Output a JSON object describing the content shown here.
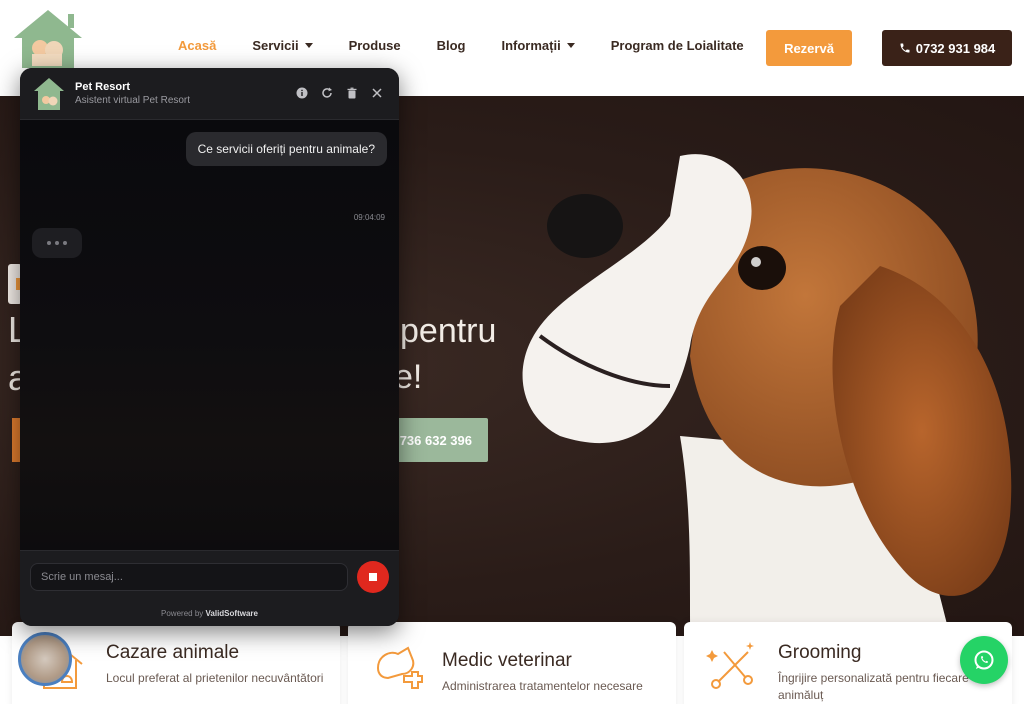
{
  "header": {
    "nav": [
      {
        "label": "Acasă",
        "active": true,
        "dropdown": false
      },
      {
        "label": "Servicii",
        "active": false,
        "dropdown": true
      },
      {
        "label": "Produse",
        "active": false,
        "dropdown": false
      },
      {
        "label": "Blog",
        "active": false,
        "dropdown": false
      },
      {
        "label": "Informații",
        "active": false,
        "dropdown": true
      },
      {
        "label": "Program de Loialitate",
        "active": false,
        "dropdown": false
      }
    ],
    "book_label": "Rezervă",
    "phone_label": "0732 931 984"
  },
  "hero": {
    "title_line1_start": "L",
    "title_line1_end": "pentru",
    "title_line2_start": "a",
    "title_line2_end": "e!",
    "call_label": "736 632 396"
  },
  "cards": [
    {
      "title": "Cazare animale",
      "desc": "Locul preferat al prietenilor necuvântători",
      "icon": "house-pets-icon"
    },
    {
      "title": "Medic veterinar",
      "desc": "Administrarea tratamentelor necesare",
      "icon": "vet-dog-icon"
    },
    {
      "title": "Grooming",
      "desc": "Îngrijire personalizată pentru fiecare animăluț",
      "icon": "grooming-scissors-icon"
    }
  ],
  "chat": {
    "name": "Pet Resort",
    "subtitle": "Asistent virtual Pet Resort",
    "user_message": "Ce servicii oferiți pentru animale?",
    "user_message_time": "09:04:09",
    "input_placeholder": "Scrie un mesaj...",
    "powered_prefix": "Powered by",
    "powered_brand": "ValidSoftware"
  },
  "colors": {
    "accent": "#f39a3c",
    "dark_brown": "#3a2218",
    "whatsapp": "#25d366",
    "stop_red": "#e0281e"
  }
}
